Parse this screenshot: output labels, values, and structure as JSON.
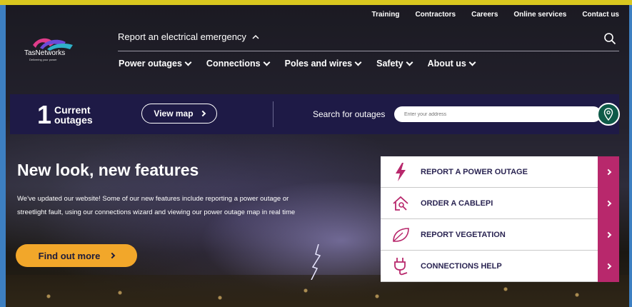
{
  "utility_nav": [
    "Training",
    "Contractors",
    "Careers",
    "Online services",
    "Contact us"
  ],
  "logo": {
    "name": "TasNetworks",
    "tagline": "Delivering your power"
  },
  "emergency": {
    "label": "Report an electrical emergency",
    "icon": "chevron-up-icon"
  },
  "main_nav": [
    "Power outages",
    "Connections",
    "Poles and wires",
    "Safety",
    "About us"
  ],
  "outage_bar": {
    "count": "1",
    "label": "Current outages",
    "view_map": "View map",
    "search_label": "Search for outages",
    "search_placeholder": "Enter your address"
  },
  "hero": {
    "title": "New look, new features",
    "body": "We've updated our website! Some of our new features include reporting a power outage or streetlight fault, using our connections wizard and viewing our power outage map in real time",
    "cta": "Find out more"
  },
  "quick_links": [
    {
      "label": "REPORT A POWER OUTAGE",
      "icon": "lightning-icon"
    },
    {
      "label": "ORDER A CABLEPI",
      "icon": "house-cable-icon"
    },
    {
      "label": "REPORT VEGETATION",
      "icon": "leaf-icon"
    },
    {
      "label": "CONNECTIONS HELP",
      "icon": "plug-icon"
    }
  ],
  "colors": {
    "accent": "#b8286c",
    "navy": "#1e1a46",
    "cta": "#f2a72a",
    "pin": "#0e5a48"
  }
}
